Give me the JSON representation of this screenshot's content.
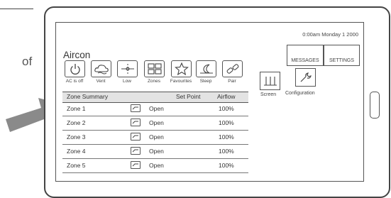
{
  "fragment_text": "of",
  "screen": {
    "clock": "0:00am Monday 1  2000",
    "title": "Aircon",
    "mode_buttons": [
      {
        "label": "AC is off",
        "icon": "power-icon"
      },
      {
        "label": "Vent",
        "icon": "cloud-vent-icon"
      },
      {
        "label": "Low",
        "icon": "fan-low-icon"
      },
      {
        "label": "Zones",
        "icon": "zones-grid-icon"
      },
      {
        "label": "Favourites",
        "icon": "star-icon"
      },
      {
        "label": "Sleep",
        "icon": "moon-icon"
      },
      {
        "label": "Pair",
        "icon": "pair-link-icon"
      }
    ],
    "top_buttons": {
      "messages": "MESSAGES",
      "settings": "SETTINGS"
    },
    "screen_button_label": "Screen",
    "configuration_button_label": "Configuration",
    "zone_table": {
      "headers": {
        "name": "Zone Summary",
        "set_point": "Set Point",
        "airflow": "Airflow"
      },
      "rows": [
        {
          "zone": "Zone 1",
          "state": "Open",
          "airflow": "100%"
        },
        {
          "zone": "Zone 2",
          "state": "Open",
          "airflow": "100%"
        },
        {
          "zone": "Zone 3",
          "state": "Open",
          "airflow": "100%"
        },
        {
          "zone": "Zone 4",
          "state": "Open",
          "airflow": "100%"
        },
        {
          "zone": "Zone 5",
          "state": "Open",
          "airflow": "100%"
        }
      ]
    }
  }
}
